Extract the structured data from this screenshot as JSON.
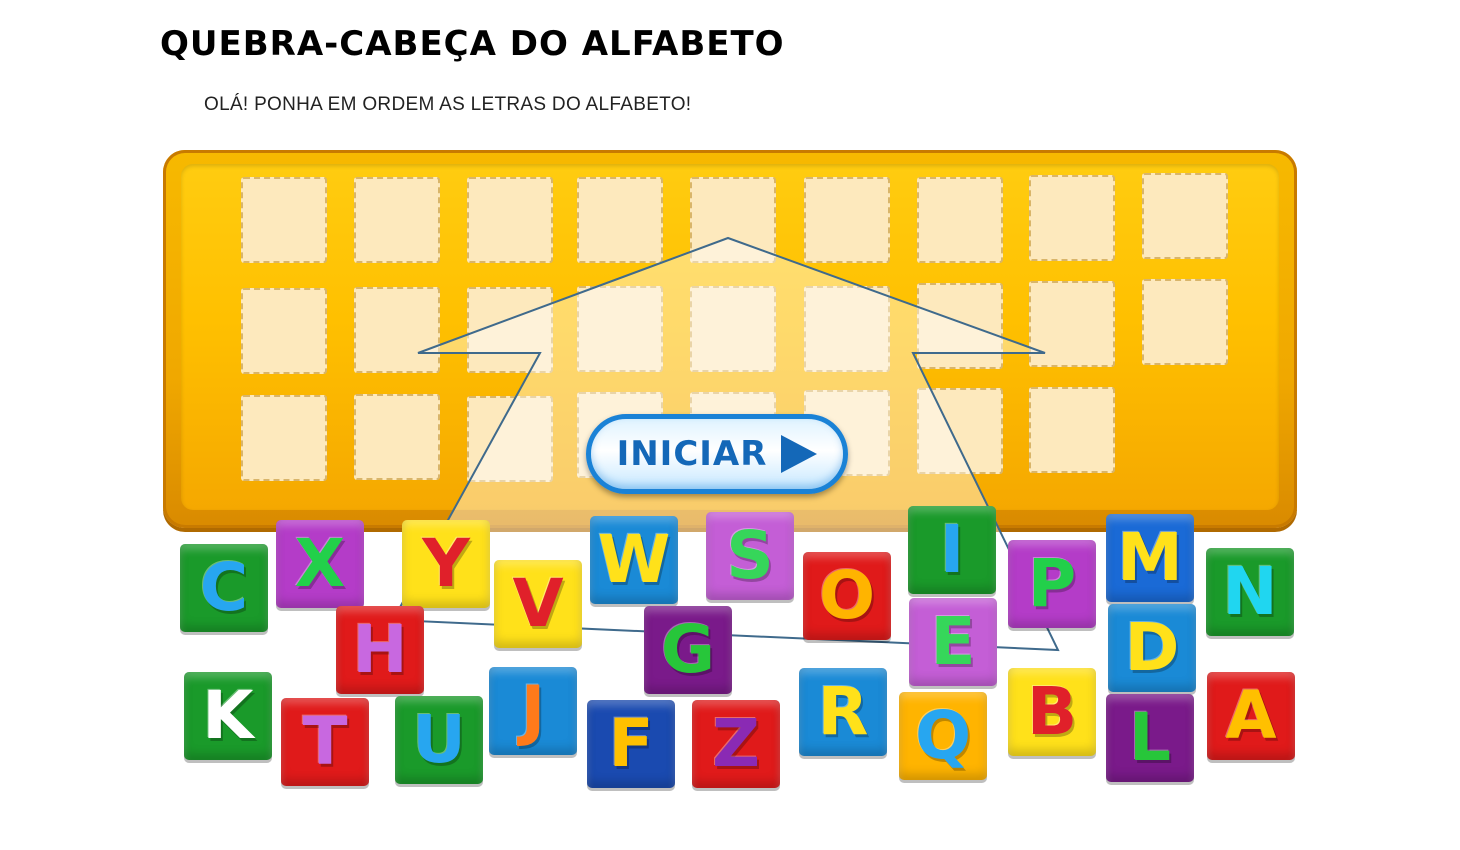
{
  "title": "QUEBRA-CABEÇA DO ALFABETO",
  "subtitle": "OLÁ! PONHA EM ORDEM AS LETRAS DO ALFABETO!",
  "start_button": {
    "label": "INICIAR",
    "icon": "play-icon"
  },
  "board": {
    "slot_count": 26,
    "color": "#ffc000"
  },
  "tiles": [
    {
      "letter": "C",
      "bg": "#1a9a2a",
      "fg": "#27a6f0"
    },
    {
      "letter": "X",
      "bg": "#b43cc8",
      "fg": "#22d04a"
    },
    {
      "letter": "Y",
      "bg": "#ffe11a",
      "fg": "#e0202a"
    },
    {
      "letter": "H",
      "bg": "#e01a1a",
      "fg": "#c868e0"
    },
    {
      "letter": "V",
      "bg": "#ffe11a",
      "fg": "#e0202a"
    },
    {
      "letter": "W",
      "bg": "#1a8ad6",
      "fg": "#ffe11a"
    },
    {
      "letter": "S",
      "bg": "#c45ed6",
      "fg": "#36d65a"
    },
    {
      "letter": "G",
      "bg": "#7a1a8a",
      "fg": "#27c63a"
    },
    {
      "letter": "O",
      "bg": "#e01a1a",
      "fg": "#ffb400"
    },
    {
      "letter": "I",
      "bg": "#1a9a2a",
      "fg": "#27a6f0"
    },
    {
      "letter": "E",
      "bg": "#c45ed6",
      "fg": "#36d65a"
    },
    {
      "letter": "P",
      "bg": "#b43cc8",
      "fg": "#22d04a"
    },
    {
      "letter": "M",
      "bg": "#1a6ad6",
      "fg": "#ffe11a"
    },
    {
      "letter": "D",
      "bg": "#1a8ad6",
      "fg": "#ffe11a"
    },
    {
      "letter": "N",
      "bg": "#1a9a2a",
      "fg": "#20d6f0"
    },
    {
      "letter": "K",
      "bg": "#1a9a2a",
      "fg": "#ffffff"
    },
    {
      "letter": "T",
      "bg": "#e01a1a",
      "fg": "#c868e0"
    },
    {
      "letter": "U",
      "bg": "#1a9a2a",
      "fg": "#27a6f0"
    },
    {
      "letter": "J",
      "bg": "#1a8ad6",
      "fg": "#ff7a1a"
    },
    {
      "letter": "F",
      "bg": "#1a4ab0",
      "fg": "#ffc000"
    },
    {
      "letter": "Z",
      "bg": "#e01a1a",
      "fg": "#8a2ab4"
    },
    {
      "letter": "R",
      "bg": "#1a8ad6",
      "fg": "#ffe11a"
    },
    {
      "letter": "Q",
      "bg": "#ffb400",
      "fg": "#27a6f0"
    },
    {
      "letter": "B",
      "bg": "#ffe11a",
      "fg": "#e0202a"
    },
    {
      "letter": "L",
      "bg": "#7a1a8a",
      "fg": "#27c63a"
    },
    {
      "letter": "A",
      "bg": "#e01a1a",
      "fg": "#ffc000"
    }
  ]
}
